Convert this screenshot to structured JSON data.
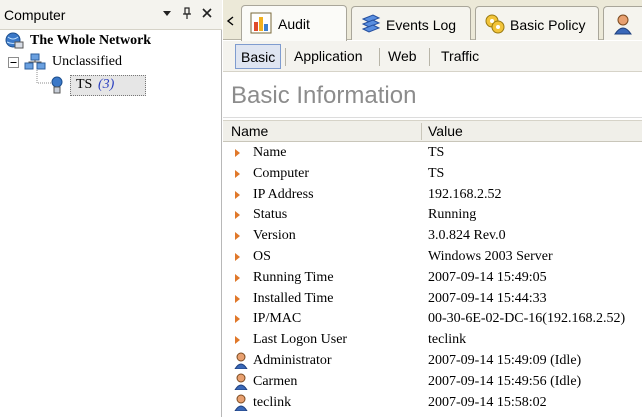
{
  "left_panel": {
    "title": "Computer",
    "tree": {
      "root_label": "The Whole Network",
      "group_label": "Unclassified",
      "node_label": "TS",
      "node_count": "(3)"
    }
  },
  "tabs": [
    {
      "label": "Audit",
      "icon": "audit-chart-icon",
      "active": true
    },
    {
      "label": "Events Log",
      "icon": "events-log-icon",
      "active": false
    },
    {
      "label": "Basic Policy",
      "icon": "basic-policy-icon",
      "active": false
    }
  ],
  "subtabs": [
    {
      "label": "Basic",
      "active": true
    },
    {
      "label": "Application",
      "active": false
    },
    {
      "label": "Web",
      "active": false
    },
    {
      "label": "Traffic",
      "active": false
    }
  ],
  "section_title": "Basic Information",
  "columns": {
    "name": "Name",
    "value": "Value"
  },
  "info_rows": [
    {
      "name": "Name",
      "value": "TS"
    },
    {
      "name": "Computer",
      "value": "TS"
    },
    {
      "name": "IP Address",
      "value": "192.168.2.52"
    },
    {
      "name": "Status",
      "value": "Running"
    },
    {
      "name": "Version",
      "value": "3.0.824 Rev.0"
    },
    {
      "name": "OS",
      "value": "Windows 2003 Server"
    },
    {
      "name": "Running Time",
      "value": "2007-09-14 15:49:05"
    },
    {
      "name": "Installed Time",
      "value": "2007-09-14 15:44:33"
    },
    {
      "name": "IP/MAC",
      "value": "00-30-6E-02-DC-16(192.168.2.52)"
    },
    {
      "name": "Last Logon User",
      "value": "teclink"
    }
  ],
  "user_rows": [
    {
      "name": "Administrator",
      "value": "2007-09-14 15:49:09 (Idle)"
    },
    {
      "name": "Carmen",
      "value": "2007-09-14 15:49:56 (Idle)"
    },
    {
      "name": "teclink",
      "value": "2007-09-14 15:58:02"
    }
  ],
  "colors": {
    "accent_bullet": "#e0782a",
    "count_blue": "#2b3fbf",
    "title_gray": "#8c8c8c"
  }
}
